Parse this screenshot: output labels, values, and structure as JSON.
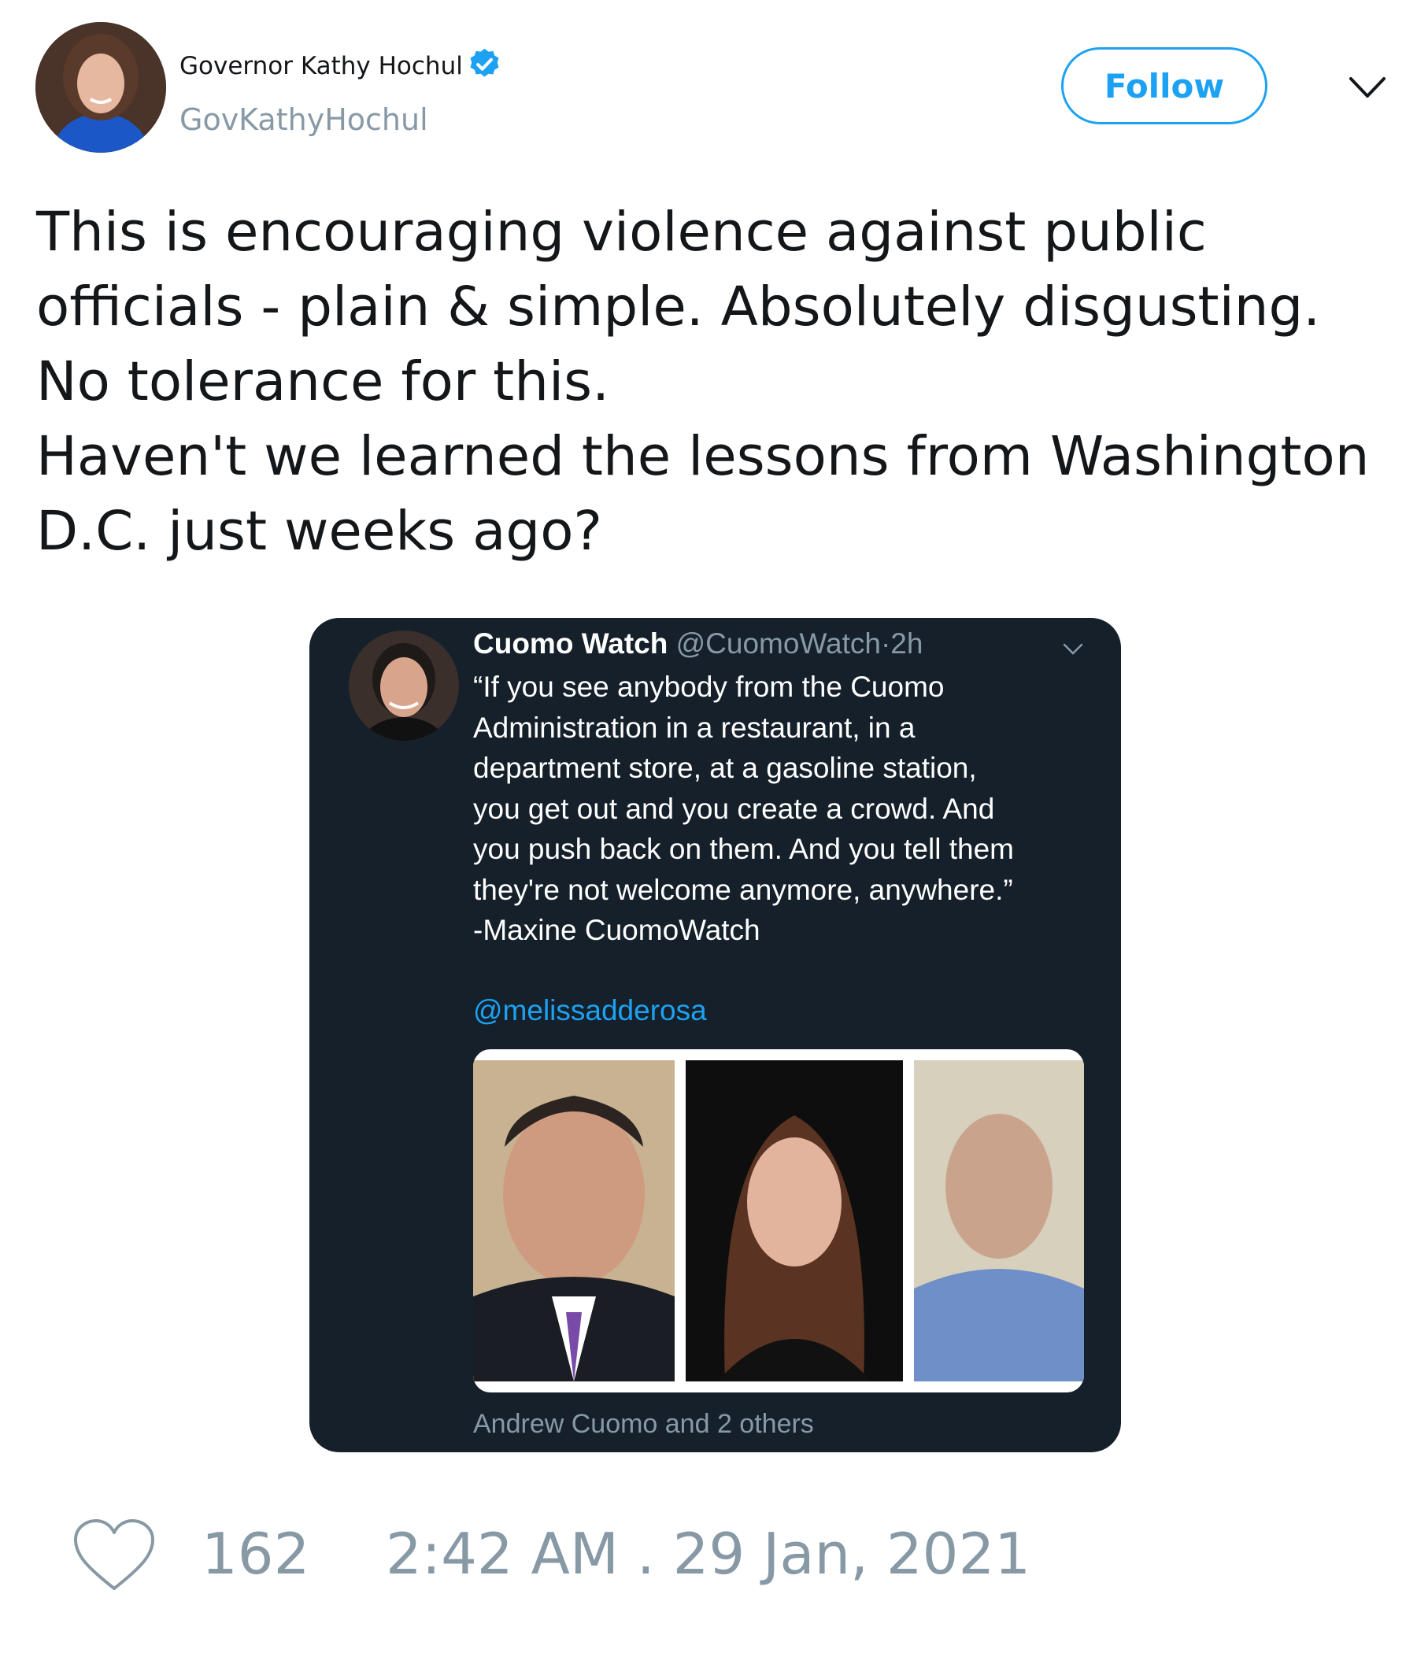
{
  "author": {
    "name": "Governor Kathy Hochul",
    "handle": "GovKathyHochul",
    "verified": true,
    "avatar_icon": "avatar-photo"
  },
  "follow_label": "Follow",
  "tweet_text": "This is encouraging violence against public\nofficials - plain & simple. Absolutely disgusting.\nNo tolerance for this.\nHaven't we learned the lessons from Washington\nD.C. just weeks ago?",
  "quoted": {
    "name": "Cuomo Watch",
    "handle": "@CuomoWatch",
    "separator": "·",
    "time": "2h",
    "text": "“If you see anybody from the Cuomo\nAdministration in a restaurant, in a\ndepartment store, at a gasoline station,\nyou get out and you create a crowd. And\nyou push back on them. And you tell them\nthey're not welcome anymore, anywhere.”\n-Maxine CuomoWatch",
    "mention": "@melissadderosa",
    "caption": "Andrew Cuomo and 2 others"
  },
  "likes_count": "162",
  "timestamp": "2:42 AM . 29 Jan, 2021",
  "colors": {
    "accent": "#1da1f2",
    "muted": "#8899a6",
    "card_bg": "#15202b",
    "text": "#14171a"
  }
}
